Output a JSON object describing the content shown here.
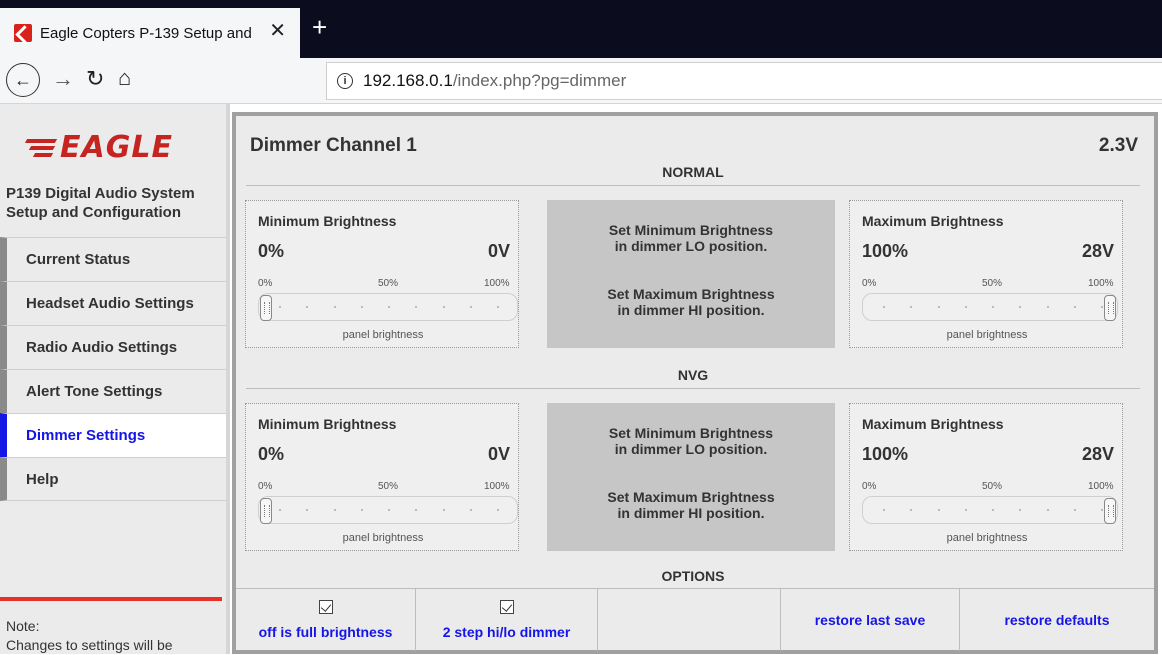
{
  "browser": {
    "tab_title": "Eagle Copters P-139 Setup and",
    "close_glyph": "✕",
    "new_tab_glyph": "+",
    "url_host": "192.168.0.1",
    "url_path": "/index.php?pg=dimmer",
    "icons": [
      "eagle-favicon",
      "back-arrow",
      "forward-arrow",
      "reload",
      "home",
      "info"
    ]
  },
  "sidebar": {
    "logo_text": "EAGLE",
    "system_title": "P139 Digital Audio System Setup and Configuration",
    "items": [
      {
        "label": "Current Status",
        "active": false
      },
      {
        "label": "Headset Audio Settings",
        "active": false
      },
      {
        "label": "Radio Audio Settings",
        "active": false
      },
      {
        "label": "Alert Tone Settings",
        "active": false
      },
      {
        "label": "Dimmer Settings",
        "active": true
      },
      {
        "label": "Help",
        "active": false
      }
    ],
    "note_label": "Note:",
    "note_text": "Changes to settings will be"
  },
  "main": {
    "channel_title": "Dimmer Channel 1",
    "voltage": "2.3V",
    "sections": [
      {
        "label": "NORMAL",
        "min": {
          "heading": "Minimum Brightness",
          "percent": "0%",
          "volts": "0V",
          "level": 0
        },
        "max": {
          "heading": "Maximum Brightness",
          "percent": "100%",
          "volts": "28V",
          "level": 1
        },
        "instructions": [
          "Set Minimum Brightness",
          "in dimmer LO position.",
          "Set Maximum Brightness",
          "in dimmer HI position."
        ]
      },
      {
        "label": "NVG",
        "min": {
          "heading": "Minimum Brightness",
          "percent": "0%",
          "volts": "0V",
          "level": 0
        },
        "max": {
          "heading": "Maximum Brightness",
          "percent": "100%",
          "volts": "28V",
          "level": 1
        },
        "instructions": [
          "Set Minimum Brightness",
          "in dimmer LO position.",
          "Set Maximum Brightness",
          "in dimmer HI position."
        ]
      }
    ],
    "slider": {
      "tick_low": "0%",
      "tick_mid": "50%",
      "tick_high": "100%",
      "caption": "panel brightness"
    },
    "options_label": "OPTIONS",
    "options": [
      {
        "label": "off is full brightness",
        "checked": true
      },
      {
        "label": "2 step hi/lo dimmer",
        "checked": true
      },
      {
        "label": ""
      },
      {
        "label": "restore last save"
      },
      {
        "label": "restore defaults"
      }
    ]
  },
  "colors": {
    "accent": "#1515e6",
    "brand_red": "#c52420",
    "panel_grey": "#c6c6c6"
  }
}
